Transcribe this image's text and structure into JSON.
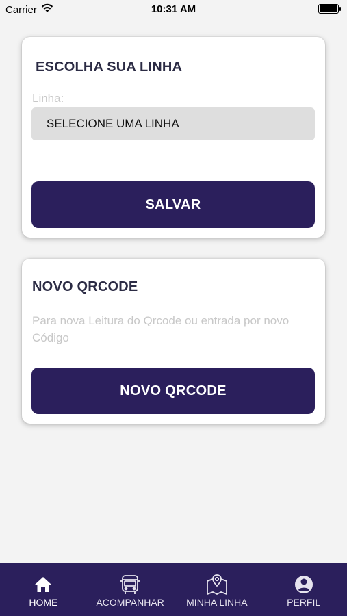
{
  "status_bar": {
    "carrier": "Carrier",
    "time": "10:31 AM"
  },
  "line_card": {
    "title": "ESCOLHA SUA LINHA",
    "field_label": "Linha:",
    "select_value": "SELECIONE UMA LINHA",
    "save_button": "SALVAR"
  },
  "qrcode_card": {
    "title": "NOVO QRCODE",
    "description": "Para nova Leitura do Qrcode ou entrada por novo Código",
    "button": "NOVO QRCODE"
  },
  "tab_bar": {
    "items": [
      {
        "label": "HOME",
        "icon": "home-icon",
        "active": true
      },
      {
        "label": "ACOMPANHAR",
        "icon": "bus-icon",
        "active": false
      },
      {
        "label": "MINHA LINHA",
        "icon": "map-icon",
        "active": false
      },
      {
        "label": "PERFIL",
        "icon": "profile-icon",
        "active": false
      }
    ]
  },
  "colors": {
    "primary": "#2b1f5c",
    "background": "#f3f3f3",
    "card": "#ffffff",
    "select_bg": "#dedede"
  }
}
